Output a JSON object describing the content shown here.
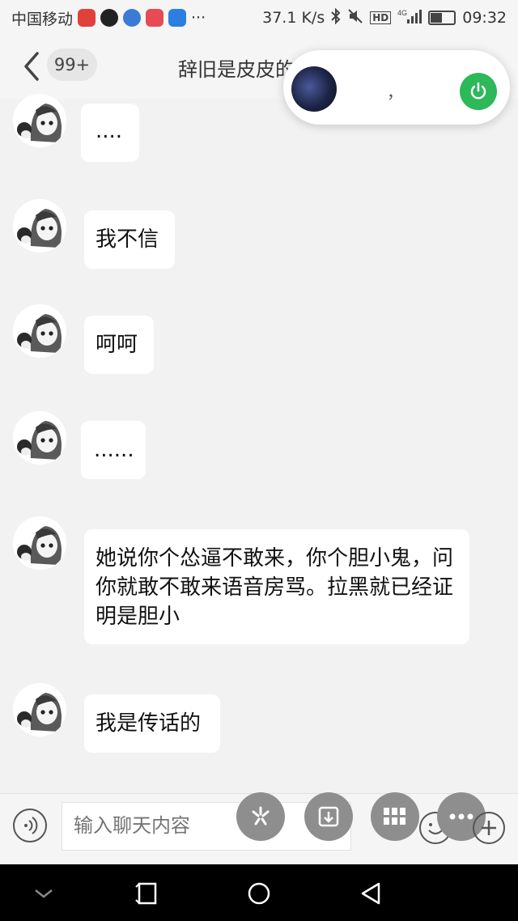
{
  "status_bar": {
    "carrier": "中国移动",
    "net_speed": "37.1 K/s",
    "network": "4G",
    "time": "09:32",
    "battery_level": 0.45,
    "notif_ellipsis": "···",
    "app_colors": [
      "#e0413a",
      "#222222",
      "#3b7bd6",
      "#e84a55",
      "#2c7fe0"
    ]
  },
  "header": {
    "back_icon": "chevron-left-icon",
    "unread_badge": "99+",
    "title": "辞旧是皮皮的"
  },
  "voice_card": {
    "name": "，",
    "power_icon": "power-icon",
    "accent": "#2db85a"
  },
  "messages": [
    {
      "text": "...."
    },
    {
      "text": "我不信"
    },
    {
      "text": "呵呵"
    },
    {
      "text": "......"
    },
    {
      "text": "她说你个怂逼不敢来，你个胆小鬼，问你就敢不敢来语音房骂。拉黑就已经证明是胆小"
    },
    {
      "text": "我是传话的"
    }
  ],
  "input_bar": {
    "placeholder": "输入聊天内容",
    "voice_icon": "sound-wave-icon",
    "fab_icons": [
      "sparkle-icon",
      "download-icon",
      "grid-icon",
      "more-icon"
    ],
    "emoji_icon": "smile-icon",
    "plus_icon": "plus-icon"
  },
  "nav_bar": {
    "icons": [
      "chevron-down-icon",
      "recent-apps-icon",
      "home-icon",
      "back-triangle-icon"
    ]
  }
}
